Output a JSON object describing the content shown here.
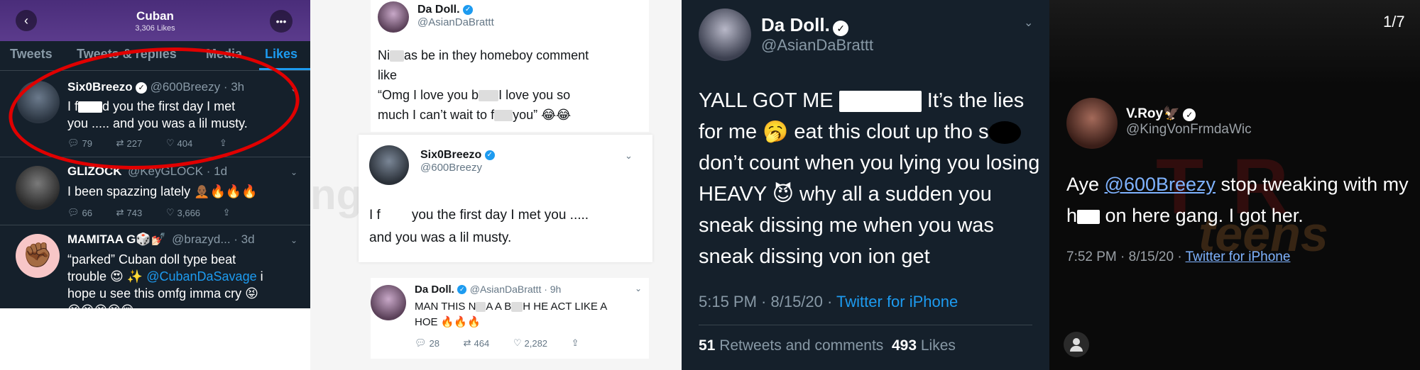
{
  "panel1": {
    "header": {
      "title": "Cuban",
      "subtitle": "3,306 Likes"
    },
    "tabs": [
      "Tweets",
      "Tweets & replies",
      "Media",
      "Likes"
    ],
    "tweets": [
      {
        "name": "Six0Breezo",
        "handle": "@600Breezy · 3h",
        "line1_pre": "I f",
        "line1_post": "d you the first day I met",
        "line2": "you ..... and you was a lil musty.",
        "replies": "79",
        "retweets": "227",
        "likes": "404"
      },
      {
        "name": "GLIZOCK",
        "handle": "@KeyGLOCK · 1d",
        "text": "I been spazzing lately 🧑🏾‍🦲🔥🔥🔥",
        "replies": "66",
        "retweets": "743",
        "likes": "3,666"
      },
      {
        "name": "MAMITAA G🎲💅🏻",
        "handle": "@brazyd... · 3d",
        "line1": "“parked” Cuban doll type beat",
        "line2_pre": "trouble 😍 ✨ ",
        "line2_mention": "@CubanDaSavage",
        "line2_post": " i",
        "line3": "hope u see this omfg imma cry 😝",
        "line4": "😫😫😫😫😢"
      }
    ]
  },
  "panel2": {
    "top_card": {
      "name": "Da Doll.",
      "handle": "@AsianDaBrattt",
      "line1_pre": "Ni",
      "line1_post": "as be in they homeboy comment",
      "line2": "like",
      "line3_pre": "“Omg I love you b",
      "line3_post": "I love you so",
      "line4_pre": "much I can’t wait to f",
      "line4_post": "you” 😂😂"
    },
    "main_card": {
      "name": "Six0Breezo",
      "handle": "@600Breezy",
      "line1_pre": "I f",
      "line1_post": "you the first day I met you .....",
      "line2": "and you was a lil musty."
    },
    "reply_card": {
      "name": "Da Doll.",
      "handle": "@AsianDaBrattt · 9h",
      "line1_pre": "MAN THIS N",
      "line1_mid": "A A B",
      "line1_post": "H HE ACT LIKE A",
      "line2": "HOE 🔥🔥🔥",
      "replies": "28",
      "retweets": "464",
      "likes": "2,282"
    }
  },
  "panel3": {
    "name": "Da Doll.",
    "handle": "@AsianDaBrattt",
    "text_pre": "YALL GOT ME",
    "text_post": "It’s the lies for me 🥱 eat this clout up tho s",
    "text_rest": " don’t count when you lying you losing HEAVY 😈 why all a sudden you sneak dissing me when you was sneak dissing von ion get",
    "time": "5:15 PM · 8/15/20 · ",
    "source": "Twitter for iPhone",
    "retweets_count": "51",
    "retweets_label": "Retweets and comments",
    "likes_count": "493",
    "likes_label": "Likes"
  },
  "panel4": {
    "counter": "1/7",
    "name": "V.Roy🦅",
    "handle": "@KingVonFrmdaWic",
    "text_pre": "Aye ",
    "mention": "@600Breezy",
    "text_post1": " stop tweaking with my h",
    "text_post2": " on here gang. I got her.",
    "time": "7:52 PM · 8/15/20 · ",
    "source": "Twitter for iPhone"
  },
  "colors": {
    "twitter_blue": "#1d9bf0",
    "dark_bg": "#15202b",
    "circle_red": "#e00000"
  }
}
